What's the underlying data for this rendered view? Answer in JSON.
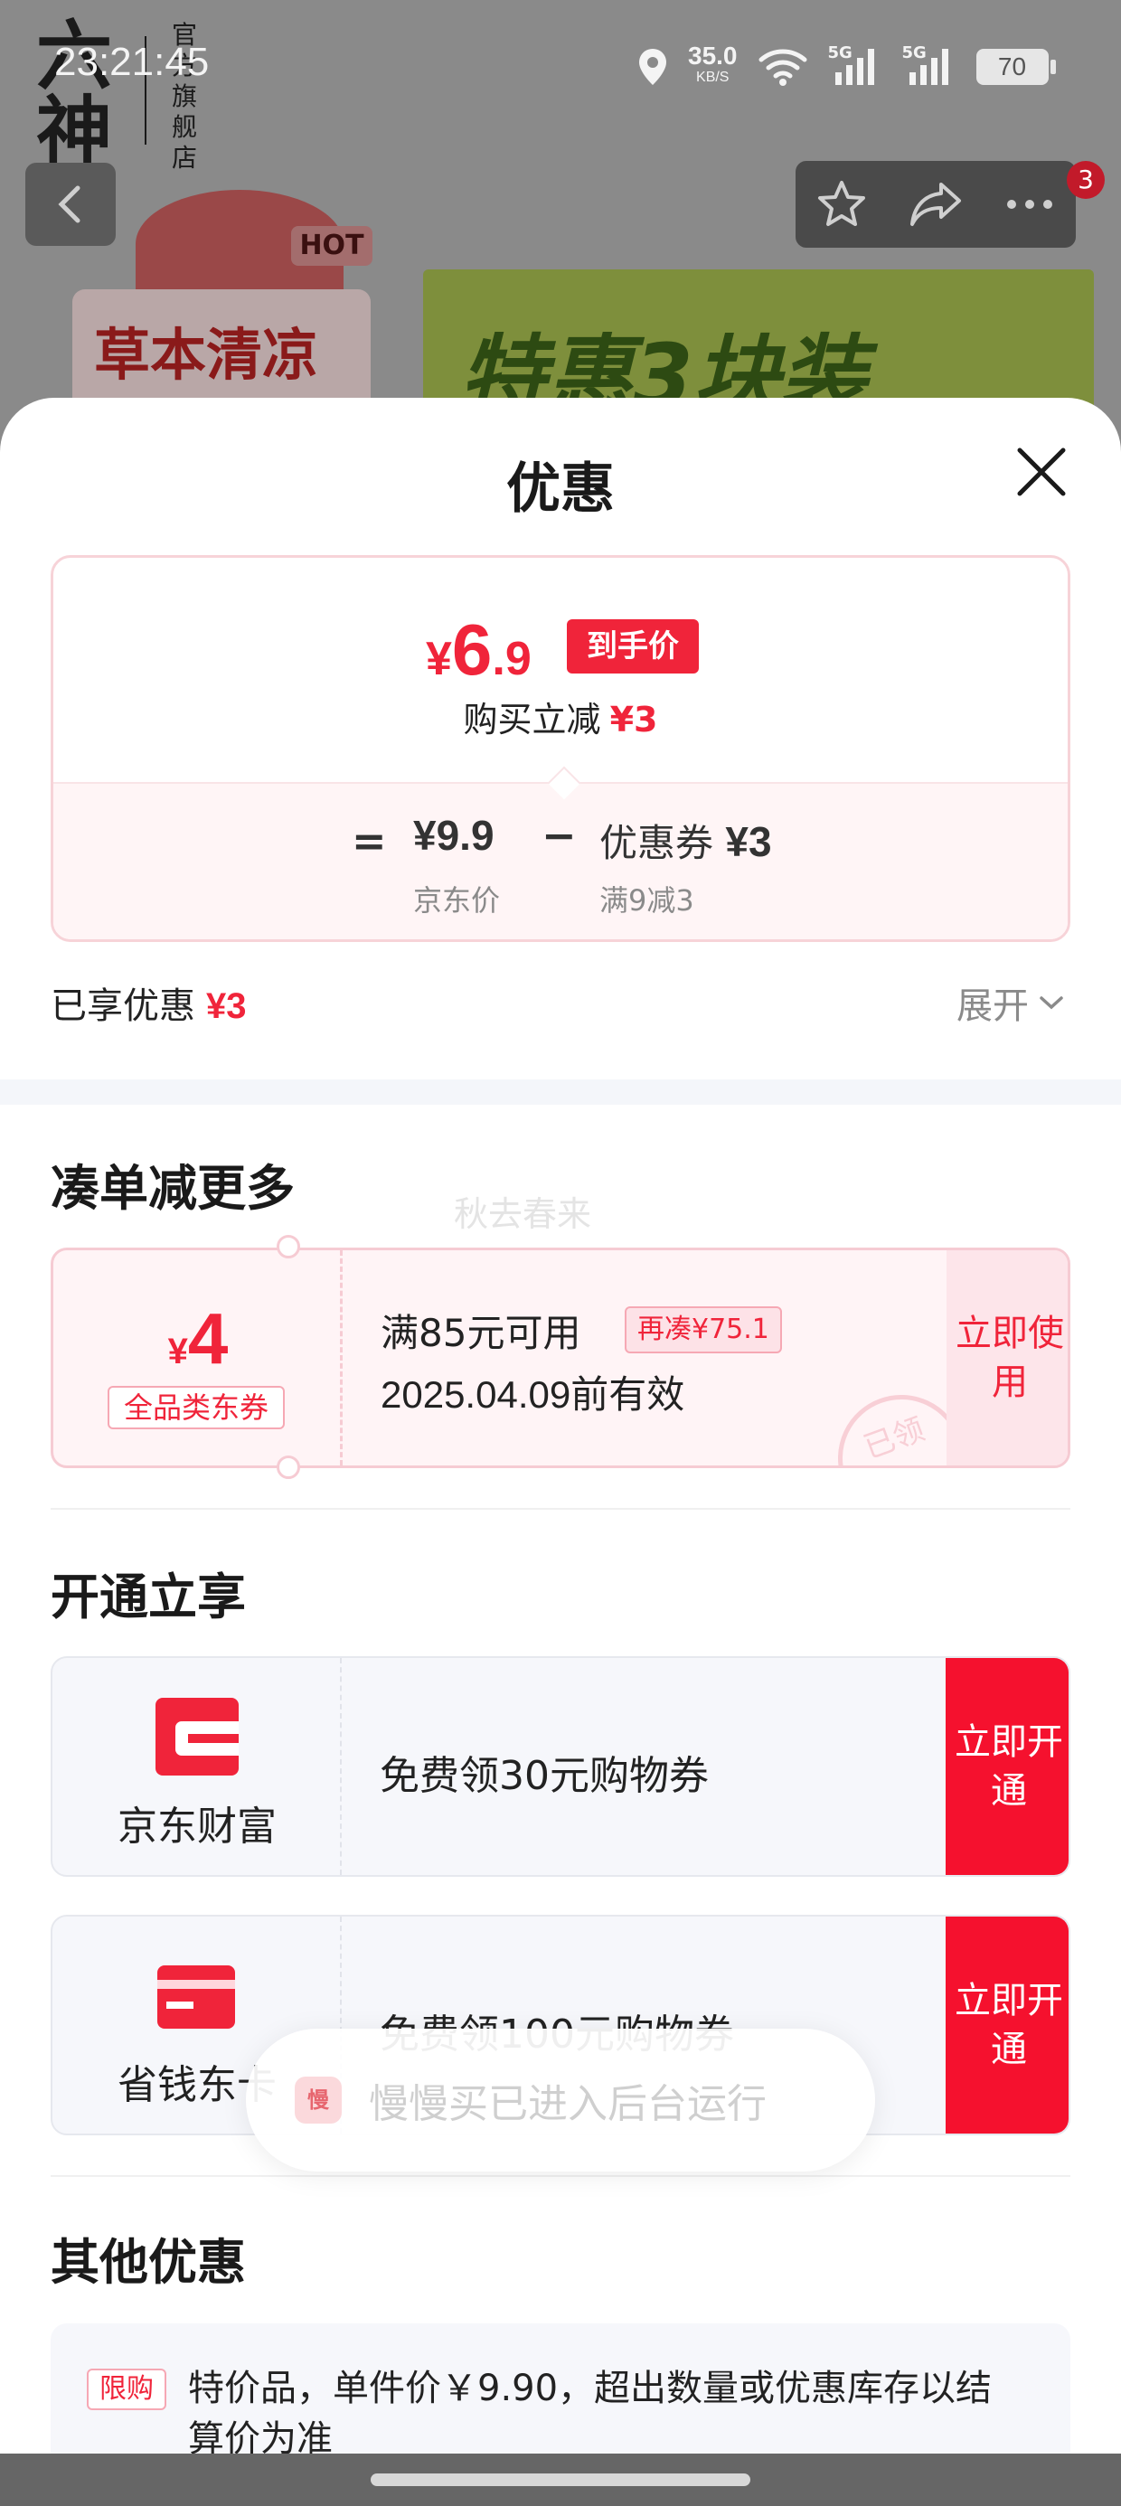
{
  "status_bar": {
    "time": "23:21:45",
    "net_speed": "35.0",
    "net_unit": "KB/S",
    "signal1": "5G",
    "signal2": "5G",
    "battery": "70"
  },
  "background": {
    "store_logo": "六神",
    "store_name_vertical": "官方旗舰店",
    "hot_tag": "HOT",
    "banner_left_text": "草本清凉",
    "banner_right_text": "特惠3块装",
    "cart_badge": "3"
  },
  "sheet": {
    "title": "优惠",
    "price_card": {
      "currency": "¥",
      "price_int": "6",
      "price_dec": ".9",
      "final_tag": "到手价",
      "reduce_label": "购买立减",
      "reduce_amount": "¥3",
      "equals": "=",
      "jd_price": "¥9.9",
      "jd_label": "京东价",
      "minus": "−",
      "coupon_name": "优惠券",
      "coupon_amount": "¥3",
      "coupon_rule": "满9减3"
    },
    "enjoyed": {
      "label": "已享优惠",
      "amount": "¥3",
      "expand_label": "展开"
    },
    "more_section": {
      "title": "凑单减更多",
      "watermark": "秋去春来",
      "coupon": {
        "currency": "¥",
        "amount": "4",
        "kind": "全品类东券",
        "condition": "满85元可用",
        "add_more": "再凑¥75.1",
        "expiry": "2025.04.09前有效",
        "stamp": "已领",
        "button": "立即使用"
      }
    },
    "open_section": {
      "title": "开通立享",
      "services": [
        {
          "name": "京东财富",
          "desc": "免费领30元购物券",
          "button": "立即开通",
          "color": "#f5112e"
        },
        {
          "name": "省钱东卡",
          "desc": "免费领100元购物券",
          "button": "立即开通",
          "color": "#f5112e"
        }
      ]
    },
    "toast": {
      "icon_label": "慢",
      "text": "慢慢买已进入后台运行"
    },
    "other_section": {
      "title": "其他优惠",
      "limit_tag": "限购",
      "limit_text": "特价品，单件价￥9.90，超出数量或优惠库存以结算价为准"
    }
  },
  "colors": {
    "accent": "#f0243a",
    "button_red": "#f5112e"
  }
}
